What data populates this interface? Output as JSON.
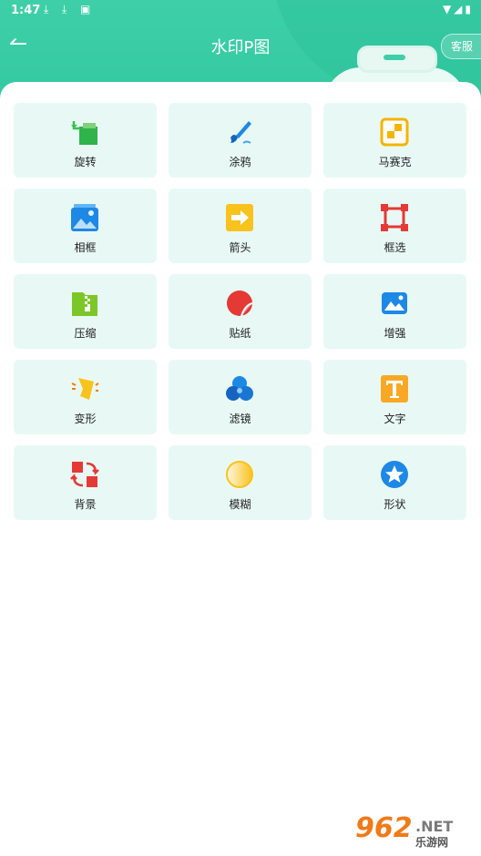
{
  "status_bar": {
    "time": "1:47"
  },
  "header": {
    "title": "水印P图",
    "service_label": "客服"
  },
  "tools": [
    {
      "label": "旋转",
      "icon": "rotate-icon"
    },
    {
      "label": "涂鸦",
      "icon": "brush-icon"
    },
    {
      "label": "马赛克",
      "icon": "mosaic-icon"
    },
    {
      "label": "相框",
      "icon": "photo-frame-icon"
    },
    {
      "label": "箭头",
      "icon": "arrow-icon"
    },
    {
      "label": "框选",
      "icon": "crop-select-icon"
    },
    {
      "label": "压缩",
      "icon": "compress-icon"
    },
    {
      "label": "贴纸",
      "icon": "sticker-icon"
    },
    {
      "label": "增强",
      "icon": "enhance-icon"
    },
    {
      "label": "变形",
      "icon": "transform-icon"
    },
    {
      "label": "滤镜",
      "icon": "filter-icon"
    },
    {
      "label": "文字",
      "icon": "text-icon"
    },
    {
      "label": "背景",
      "icon": "background-icon"
    },
    {
      "label": "模糊",
      "icon": "blur-icon"
    },
    {
      "label": "形状",
      "icon": "shape-icon"
    }
  ],
  "watermark": {
    "number": "962",
    "suffix": ".NET",
    "site": "乐游网"
  },
  "colors": {
    "header": "#3fcfa8",
    "tile_bg": "#e8f9f5"
  }
}
